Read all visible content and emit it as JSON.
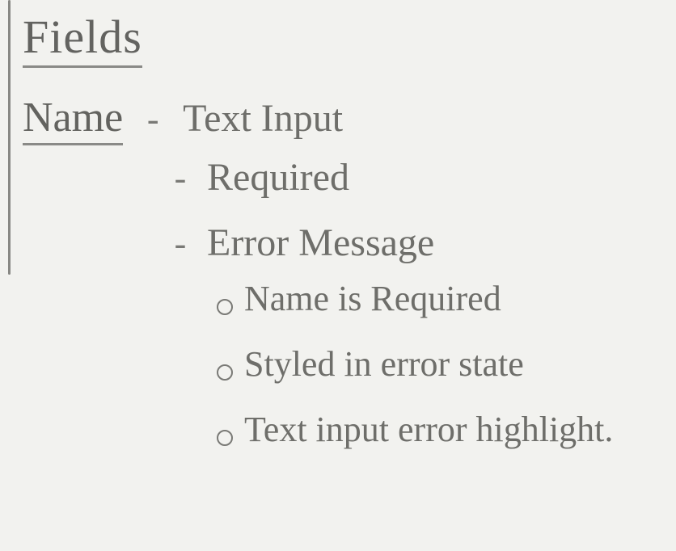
{
  "heading": "Fields",
  "field": {
    "name": "Name",
    "attributes": [
      "Text Input",
      "Required"
    ],
    "error_section": {
      "label": "Error Message",
      "items": [
        "Name is Required",
        "Styled in error state",
        "Text input error highlight."
      ]
    }
  }
}
